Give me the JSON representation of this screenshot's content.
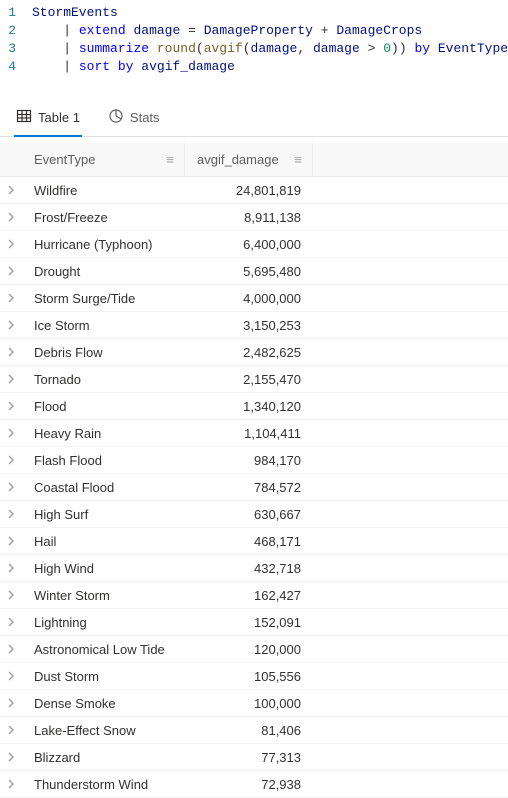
{
  "editor": {
    "lines": [
      {
        "n": "1",
        "html": "<span class='id'>StormEvents</span>"
      },
      {
        "n": "2",
        "html": "<span class='pipe'>|</span> <span class='kw'>extend</span> <span class='col'>damage</span> <span class='op'>=</span> <span class='col'>DamageProperty</span> <span class='op'>+</span> <span class='col'>DamageCrops</span>"
      },
      {
        "n": "3",
        "html": "<span class='pipe'>|</span> <span class='kw'>summarize</span> <span class='fn'>round</span><span class='op'>(</span><span class='fn'>avgif</span><span class='op'>(</span><span class='col'>damage</span><span class='op'>,</span> <span class='col'>damage</span> <span class='op'>&gt;</span> <span class='num'>0</span><span class='op'>))</span> <span class='by'>by</span> <span class='col'>EventType</span>"
      },
      {
        "n": "4",
        "html": "<span class='pipe'>|</span> <span class='kw'>sort</span> <span class='by'>by</span> <span class='col'>avgif_damage</span>"
      }
    ]
  },
  "tabs": {
    "table": "Table 1",
    "stats": "Stats"
  },
  "columns": {
    "c1": "EventType",
    "c2": "avgif_damage",
    "menu_glyph": "≡"
  },
  "rows": [
    {
      "event": "Wildfire",
      "val": "24,801,819"
    },
    {
      "event": "Frost/Freeze",
      "val": "8,911,138"
    },
    {
      "event": "Hurricane (Typhoon)",
      "val": "6,400,000"
    },
    {
      "event": "Drought",
      "val": "5,695,480"
    },
    {
      "event": "Storm Surge/Tide",
      "val": "4,000,000"
    },
    {
      "event": "Ice Storm",
      "val": "3,150,253"
    },
    {
      "event": "Debris Flow",
      "val": "2,482,625"
    },
    {
      "event": "Tornado",
      "val": "2,155,470"
    },
    {
      "event": "Flood",
      "val": "1,340,120"
    },
    {
      "event": "Heavy Rain",
      "val": "1,104,411"
    },
    {
      "event": "Flash Flood",
      "val": "984,170"
    },
    {
      "event": "Coastal Flood",
      "val": "784,572"
    },
    {
      "event": "High Surf",
      "val": "630,667"
    },
    {
      "event": "Hail",
      "val": "468,171"
    },
    {
      "event": "High Wind",
      "val": "432,718"
    },
    {
      "event": "Winter Storm",
      "val": "162,427"
    },
    {
      "event": "Lightning",
      "val": "152,091"
    },
    {
      "event": "Astronomical Low Tide",
      "val": "120,000"
    },
    {
      "event": "Dust Storm",
      "val": "105,556"
    },
    {
      "event": "Dense Smoke",
      "val": "100,000"
    },
    {
      "event": "Lake-Effect Snow",
      "val": "81,406"
    },
    {
      "event": "Blizzard",
      "val": "77,313"
    },
    {
      "event": "Thunderstorm Wind",
      "val": "72,938"
    }
  ],
  "chart_data": {
    "type": "table",
    "title": "avgif_damage by EventType",
    "columns": [
      "EventType",
      "avgif_damage"
    ],
    "data": [
      [
        "Wildfire",
        24801819
      ],
      [
        "Frost/Freeze",
        8911138
      ],
      [
        "Hurricane (Typhoon)",
        6400000
      ],
      [
        "Drought",
        5695480
      ],
      [
        "Storm Surge/Tide",
        4000000
      ],
      [
        "Ice Storm",
        3150253
      ],
      [
        "Debris Flow",
        2482625
      ],
      [
        "Tornado",
        2155470
      ],
      [
        "Flood",
        1340120
      ],
      [
        "Heavy Rain",
        1104411
      ],
      [
        "Flash Flood",
        984170
      ],
      [
        "Coastal Flood",
        784572
      ],
      [
        "High Surf",
        630667
      ],
      [
        "Hail",
        468171
      ],
      [
        "High Wind",
        432718
      ],
      [
        "Winter Storm",
        162427
      ],
      [
        "Lightning",
        152091
      ],
      [
        "Astronomical Low Tide",
        120000
      ],
      [
        "Dust Storm",
        105556
      ],
      [
        "Dense Smoke",
        100000
      ],
      [
        "Lake-Effect Snow",
        81406
      ],
      [
        "Blizzard",
        77313
      ],
      [
        "Thunderstorm Wind",
        72938
      ]
    ]
  }
}
